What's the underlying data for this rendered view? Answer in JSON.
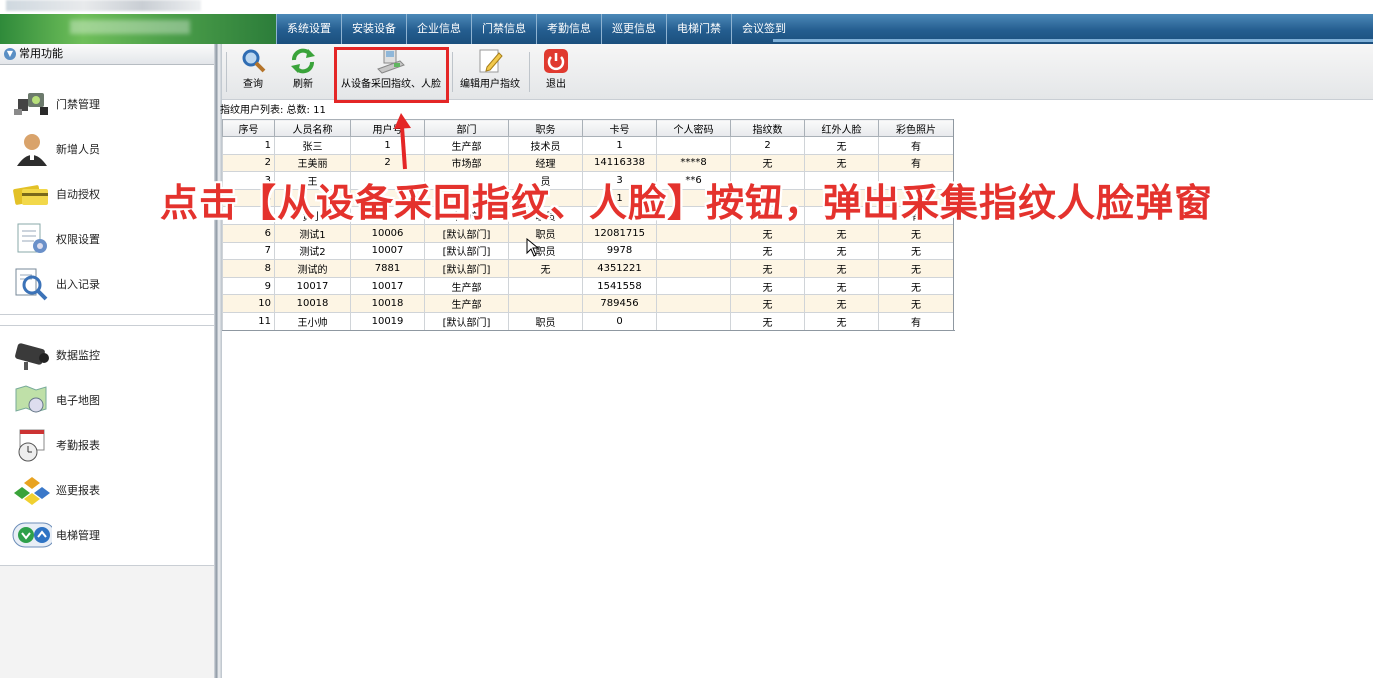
{
  "menu": {
    "items": [
      "系统设置",
      "安装设备",
      "企业信息",
      "门禁信息",
      "考勤信息",
      "巡更信息",
      "电梯门禁",
      "会议签到"
    ]
  },
  "sidebar": {
    "header": "常用功能",
    "group1": [
      {
        "label": "门禁管理",
        "icon": "access-control-icon"
      },
      {
        "label": "新增人员",
        "icon": "person-icon"
      },
      {
        "label": "自动授权",
        "icon": "cards-icon"
      },
      {
        "label": "权限设置",
        "icon": "permission-doc-icon"
      },
      {
        "label": "出入记录",
        "icon": "record-search-icon"
      }
    ],
    "group2": [
      {
        "label": "数据监控",
        "icon": "camera-icon"
      },
      {
        "label": "电子地图",
        "icon": "map-icon"
      },
      {
        "label": "考勤报表",
        "icon": "clock-report-icon"
      },
      {
        "label": "巡更报表",
        "icon": "patrol-report-icon"
      },
      {
        "label": "电梯管理",
        "icon": "elevator-icon"
      }
    ]
  },
  "toolbar": {
    "query": "查询",
    "refresh": "刷新",
    "collect": "从设备采回指纹、人脸",
    "edit": "编辑用户指纹",
    "exit": "退出"
  },
  "list_label": "指纹用户列表: 总数: 11",
  "table": {
    "headers": [
      "序号",
      "人员名称",
      "用户号",
      "部门",
      "职务",
      "卡号",
      "个人密码",
      "指纹数",
      "红外人脸",
      "彩色照片"
    ],
    "rows": [
      [
        "1",
        "张三",
        "1",
        "生产部",
        "技术员",
        "1",
        "",
        "2",
        "无",
        "有"
      ],
      [
        "2",
        "王美丽",
        "2",
        "市场部",
        "经理",
        "14116338",
        "****8",
        "无",
        "无",
        "有"
      ],
      [
        "3",
        "王",
        "",
        "",
        "员",
        "3",
        "**6",
        "",
        "",
        ""
      ],
      [
        "4",
        "",
        "",
        "",
        "",
        "1",
        "",
        "",
        "",
        ""
      ],
      [
        "5",
        "黄小",
        "",
        "市场部",
        "职员",
        "0",
        "",
        "无",
        "",
        "有"
      ],
      [
        "6",
        "测试1",
        "10006",
        "[默认部门]",
        "职员",
        "12081715",
        "",
        "无",
        "无",
        "无"
      ],
      [
        "7",
        "测试2",
        "10007",
        "[默认部门]",
        "职员",
        "9978",
        "",
        "无",
        "无",
        "无"
      ],
      [
        "8",
        "测试的",
        "7881",
        "[默认部门]",
        "无",
        "4351221",
        "",
        "无",
        "无",
        "无"
      ],
      [
        "9",
        "10017",
        "10017",
        "生产部",
        "",
        "1541558",
        "",
        "无",
        "无",
        "无"
      ],
      [
        "10",
        "10018",
        "10018",
        "生产部",
        "",
        "789456",
        "",
        "无",
        "无",
        "无"
      ],
      [
        "11",
        "王小帅",
        "10019",
        "[默认部门]",
        "职员",
        "0",
        "",
        "无",
        "无",
        "有"
      ]
    ]
  },
  "annotation": {
    "text": "点击【从设备采回指纹、人脸】按钮，弹出采集指纹人脸弹窗",
    "color": "#e4322d"
  }
}
